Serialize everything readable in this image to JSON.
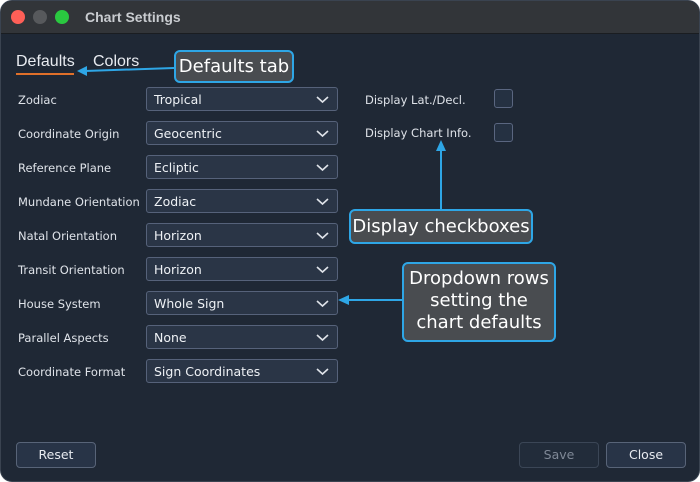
{
  "window": {
    "title": "Chart Settings"
  },
  "tabs": [
    {
      "label": "Defaults"
    },
    {
      "label": "Colors"
    }
  ],
  "settings": [
    {
      "label": "Zodiac",
      "value": "Tropical"
    },
    {
      "label": "Coordinate Origin",
      "value": "Geocentric"
    },
    {
      "label": "Reference Plane",
      "value": "Ecliptic"
    },
    {
      "label": "Mundane Orientation",
      "value": "Zodiac"
    },
    {
      "label": "Natal Orientation",
      "value": "Horizon"
    },
    {
      "label": "Transit Orientation",
      "value": "Horizon"
    },
    {
      "label": "House System",
      "value": "Whole Sign"
    },
    {
      "label": "Parallel Aspects",
      "value": "None"
    },
    {
      "label": "Coordinate Format",
      "value": "Sign Coordinates"
    }
  ],
  "checkboxes": [
    {
      "label": "Display Lat./Decl.",
      "checked": false
    },
    {
      "label": "Display Chart Info.",
      "checked": false
    }
  ],
  "buttons": {
    "reset": "Reset",
    "save": "Save",
    "close": "Close"
  },
  "callouts": {
    "defaults_tab": "Defaults tab",
    "checkboxes": "Display checkboxes",
    "dropdowns_lines": [
      "Dropdown rows",
      "setting the",
      "chart defaults"
    ]
  },
  "colors": {
    "window_bg": "#1f2835",
    "accent_underline": "#e0702a",
    "callout_border": "#2ea6e6",
    "callout_bg": "#494c50",
    "traffic_close": "#fe5f57",
    "traffic_max": "#2ac840"
  }
}
